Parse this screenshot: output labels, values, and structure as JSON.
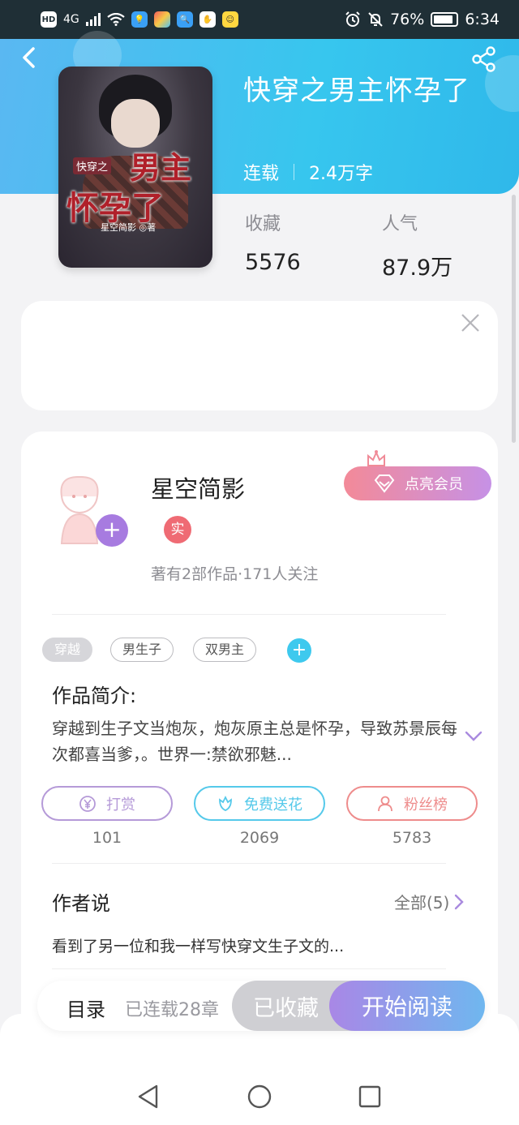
{
  "status_bar": {
    "left_badges": [
      "HD",
      "4G"
    ],
    "battery": "76%",
    "time": "6:34"
  },
  "header": {
    "book_title": "快穿之男主怀孕了",
    "status": "连载",
    "word_count": "2.4万字"
  },
  "cover": {
    "small_text": "快穿之",
    "title_line_1": "男主",
    "title_line_2": "怀孕了",
    "author_text": "星空简影 ◎著"
  },
  "stats": [
    {
      "label": "收藏",
      "value": "5576"
    },
    {
      "label": "人气",
      "value": "87.9万"
    }
  ],
  "author": {
    "name": "星空简影",
    "badge": "实",
    "subtitle": "著有2部作品·171人关注",
    "vip_label": "点亮会员",
    "follow_symbol": "+"
  },
  "tags": [
    "穿越",
    "男生子",
    "双男主"
  ],
  "tag_add_symbol": "+",
  "intro": {
    "title": "作品简介:",
    "text": "穿越到生子文当炮灰，炮灰原主总是怀孕，导致苏景辰每次都喜当爹，。世界一:禁欲邪魅..."
  },
  "actions": [
    {
      "label": "打赏",
      "count": "101",
      "color": "#b59ad8"
    },
    {
      "label": "免费送花",
      "count": "2069",
      "color": "#55c9ea"
    },
    {
      "label": "粉丝榜",
      "count": "5783",
      "color": "#ee8c8c"
    }
  ],
  "author_says": {
    "title": "作者说",
    "all_label": "全部(5)",
    "preview": "看到了另一位和我一样写快穿文生子文的..."
  },
  "bottom_bar": {
    "toc_label": "目录",
    "toc_count": "已连载28章",
    "favorited_label": "已收藏",
    "read_label": "开始阅读"
  },
  "colors": {
    "header_blue": "#37c6ee",
    "accent_purple": "#a77be0",
    "vip_pink": "#f38a98"
  }
}
